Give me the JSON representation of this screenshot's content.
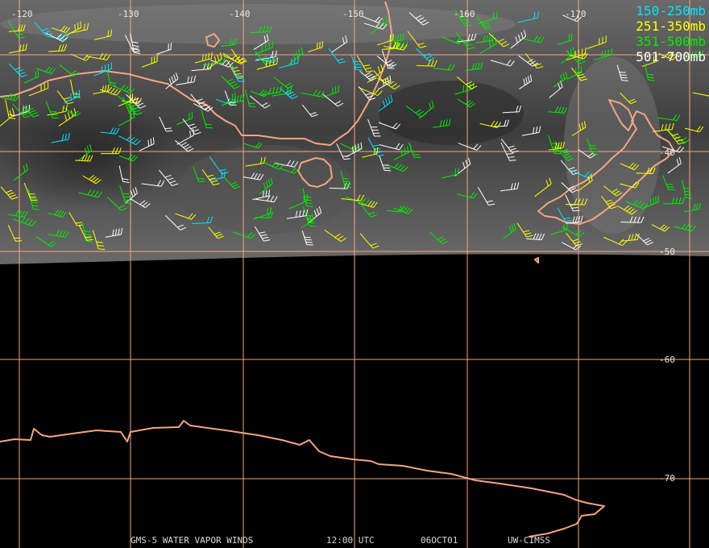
{
  "legend": {
    "items": [
      {
        "label": "150-250mb",
        "color": "#00e5ff"
      },
      {
        "label": "251-350mb",
        "color": "#ffff00"
      },
      {
        "label": "351-500mb",
        "color": "#00ee00"
      },
      {
        "label": "501-700mb",
        "color": "#ffffff"
      }
    ]
  },
  "footer": {
    "satellite": "GMS-5 WATER VAPOR WINDS",
    "time": "12:00 UTC",
    "date": "06OCT01",
    "source": "UW-CIMSS"
  },
  "grid": {
    "longitude_labels": [
      "-120",
      "-130",
      "-140",
      "-150",
      "-160",
      "-170"
    ],
    "latitude_labels": [
      "-40",
      "-50",
      "-60",
      "-70"
    ]
  },
  "colors": {
    "coastline": "#f4a582",
    "gridline": "#f4a582",
    "background": "#000000"
  }
}
